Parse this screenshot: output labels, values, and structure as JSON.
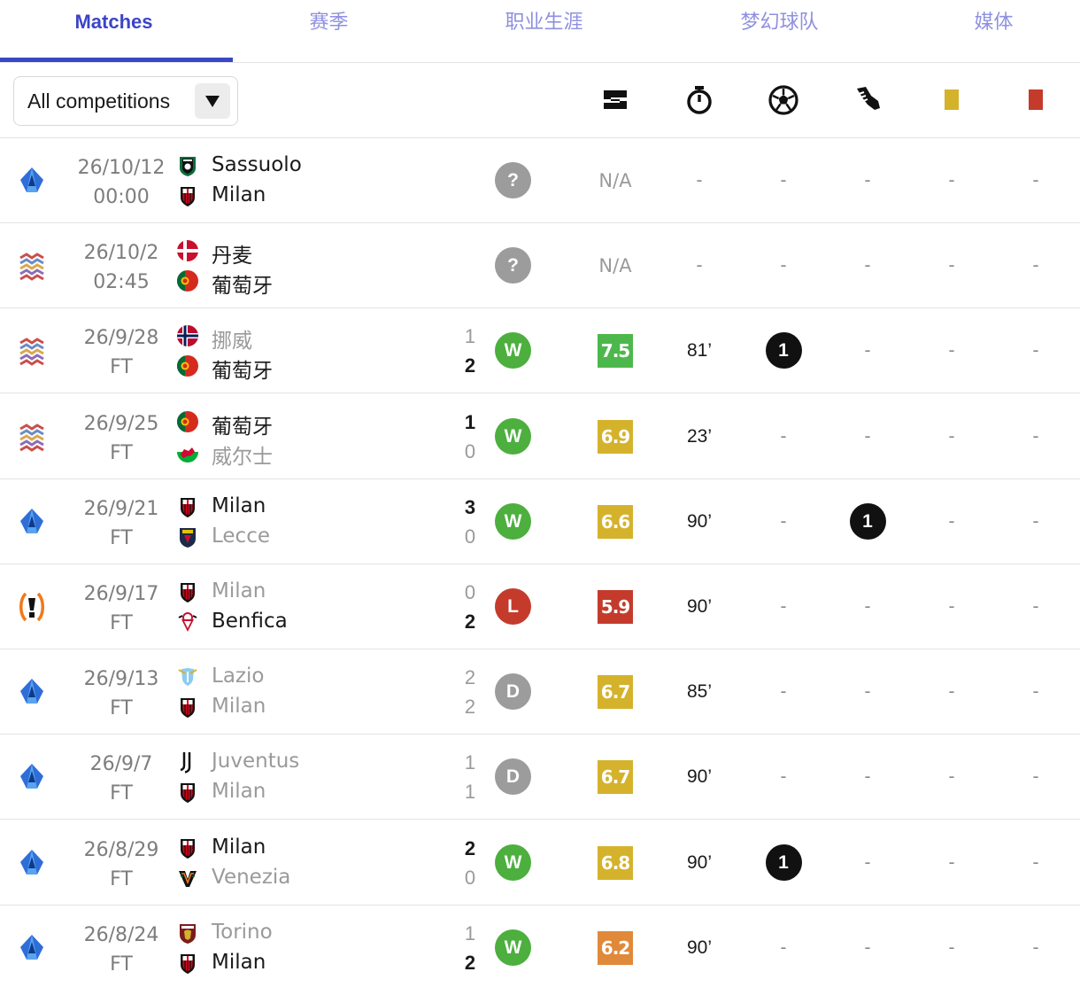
{
  "tabs": [
    {
      "label": "Matches",
      "active": true
    },
    {
      "label": "赛季",
      "active": false
    },
    {
      "label": "职业生涯",
      "active": false
    },
    {
      "label": "梦幻球队",
      "active": false
    },
    {
      "label": "媒体",
      "active": false
    }
  ],
  "filter": {
    "selected": "All competitions"
  },
  "columns": [
    "lineup-icon",
    "stopwatch-icon",
    "football-icon",
    "boot-icon",
    "yellow-card-icon",
    "red-card-icon"
  ],
  "colors": {
    "win": "#4caf3e",
    "draw": "#9c9c9c",
    "loss": "#c43b2c",
    "accent": "#3947c5",
    "yellow": "#d4b22c",
    "red": "#c43b2c"
  },
  "matches": [
    {
      "comp": "serie-a",
      "date": "26/10/12",
      "time": "00:00",
      "home": {
        "name": "Sassuolo",
        "crest": "sassuolo",
        "bold": true
      },
      "away": {
        "name": "Milan",
        "crest": "milan",
        "bold": true
      },
      "score_home": "",
      "score_away": "",
      "result": "?",
      "rating": "N/A",
      "minutes": "-",
      "goals": "-",
      "assists": "-",
      "yellow": "-",
      "red": "-"
    },
    {
      "comp": "nations-league",
      "date": "26/10/2",
      "time": "02:45",
      "home": {
        "name": "丹麦",
        "crest": "denmark",
        "bold": true
      },
      "away": {
        "name": "葡萄牙",
        "crest": "portugal",
        "bold": true
      },
      "score_home": "",
      "score_away": "",
      "result": "?",
      "rating": "N/A",
      "minutes": "-",
      "goals": "-",
      "assists": "-",
      "yellow": "-",
      "red": "-"
    },
    {
      "comp": "nations-league",
      "date": "26/9/28",
      "time": "FT",
      "home": {
        "name": "挪威",
        "crest": "norway",
        "bold": false
      },
      "away": {
        "name": "葡萄牙",
        "crest": "portugal",
        "bold": true
      },
      "score_home": "1",
      "score_away": "2",
      "result": "W",
      "rating": "7.5",
      "minutes": "81’",
      "goals": "1",
      "assists": "-",
      "yellow": "-",
      "red": "-"
    },
    {
      "comp": "nations-league",
      "date": "26/9/25",
      "time": "FT",
      "home": {
        "name": "葡萄牙",
        "crest": "portugal",
        "bold": true
      },
      "away": {
        "name": "威尔士",
        "crest": "wales",
        "bold": false
      },
      "score_home": "1",
      "score_away": "0",
      "result": "W",
      "rating": "6.9",
      "minutes": "23’",
      "goals": "-",
      "assists": "-",
      "yellow": "-",
      "red": "-"
    },
    {
      "comp": "serie-a",
      "date": "26/9/21",
      "time": "FT",
      "home": {
        "name": "Milan",
        "crest": "milan",
        "bold": true
      },
      "away": {
        "name": "Lecce",
        "crest": "lecce",
        "bold": false
      },
      "score_home": "3",
      "score_away": "0",
      "result": "W",
      "rating": "6.6",
      "minutes": "90’",
      "goals": "-",
      "assists": "1",
      "yellow": "-",
      "red": "-"
    },
    {
      "comp": "europa-league",
      "date": "26/9/17",
      "time": "FT",
      "home": {
        "name": "Milan",
        "crest": "milan",
        "bold": false
      },
      "away": {
        "name": "Benfica",
        "crest": "benfica",
        "bold": true
      },
      "score_home": "0",
      "score_away": "2",
      "result": "L",
      "rating": "5.9",
      "minutes": "90’",
      "goals": "-",
      "assists": "-",
      "yellow": "-",
      "red": "-"
    },
    {
      "comp": "serie-a",
      "date": "26/9/13",
      "time": "FT",
      "home": {
        "name": "Lazio",
        "crest": "lazio",
        "bold": false
      },
      "away": {
        "name": "Milan",
        "crest": "milan",
        "bold": false
      },
      "score_home": "2",
      "score_away": "2",
      "result": "D",
      "rating": "6.7",
      "minutes": "85’",
      "goals": "-",
      "assists": "-",
      "yellow": "-",
      "red": "-"
    },
    {
      "comp": "serie-a",
      "date": "26/9/7",
      "time": "FT",
      "home": {
        "name": "Juventus",
        "crest": "juventus",
        "bold": false
      },
      "away": {
        "name": "Milan",
        "crest": "milan",
        "bold": false
      },
      "score_home": "1",
      "score_away": "1",
      "result": "D",
      "rating": "6.7",
      "minutes": "90’",
      "goals": "-",
      "assists": "-",
      "yellow": "-",
      "red": "-"
    },
    {
      "comp": "serie-a",
      "date": "26/8/29",
      "time": "FT",
      "home": {
        "name": "Milan",
        "crest": "milan",
        "bold": true
      },
      "away": {
        "name": "Venezia",
        "crest": "venezia",
        "bold": false
      },
      "score_home": "2",
      "score_away": "0",
      "result": "W",
      "rating": "6.8",
      "minutes": "90’",
      "goals": "1",
      "assists": "-",
      "yellow": "-",
      "red": "-"
    },
    {
      "comp": "serie-a",
      "date": "26/8/24",
      "time": "FT",
      "home": {
        "name": "Torino",
        "crest": "torino",
        "bold": false
      },
      "away": {
        "name": "Milan",
        "crest": "milan",
        "bold": true
      },
      "score_home": "1",
      "score_away": "2",
      "result": "W",
      "rating": "6.2",
      "minutes": "90’",
      "goals": "-",
      "assists": "-",
      "yellow": "-",
      "red": "-"
    }
  ]
}
